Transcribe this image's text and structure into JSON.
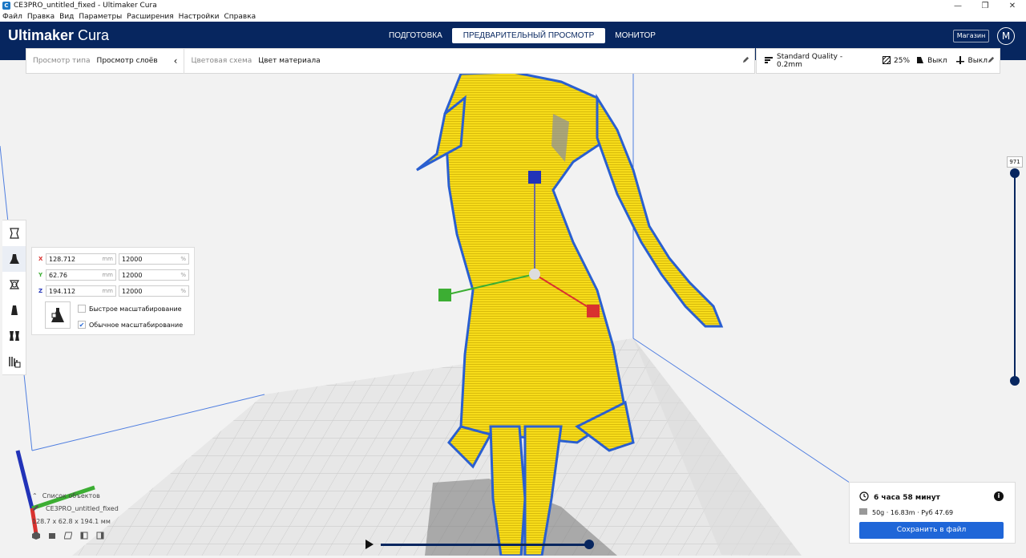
{
  "window": {
    "title": "CE3PRO_untitled_fixed - Ultimaker Cura",
    "app_icon": "C",
    "minimize": "—",
    "restore": "❐",
    "close": "✕"
  },
  "menu": [
    "Файл",
    "Правка",
    "Вид",
    "Параметры",
    "Расширения",
    "Настройки",
    "Справка"
  ],
  "header": {
    "brand_bold": "Ultimaker",
    "brand_light": " Cura",
    "stages": [
      {
        "label": "ПОДГОТОВКА",
        "active": false
      },
      {
        "label": "ПРЕДВАРИТЕЛЬНЫЙ ПРОСМОТР",
        "active": true
      },
      {
        "label": "МОНИТОР",
        "active": false
      }
    ],
    "marketplace": "Магазин",
    "avatar": "M",
    "bg_color": "#07265f"
  },
  "view_bar": {
    "view_type_label": "Просмотр типа",
    "view_type_value": "Просмотр слоёв",
    "color_scheme_label": "Цветовая схема",
    "color_scheme_value": "Цвет материала"
  },
  "print_settings": {
    "profile": "Standard Quality - 0.2mm",
    "infill": "25%",
    "support": "Выкл",
    "adhesion": "Выкл"
  },
  "scale_panel": {
    "rows": [
      {
        "axis": "X",
        "color": "#d9322f",
        "size": "128.712",
        "size_unit": "mm",
        "percent": "12000",
        "percent_unit": "%"
      },
      {
        "axis": "Y",
        "color": "#3cae33",
        "size": "62.76",
        "size_unit": "mm",
        "percent": "12000",
        "percent_unit": "%"
      },
      {
        "axis": "Z",
        "color": "#2233b8",
        "size": "194.112",
        "size_unit": "mm",
        "percent": "12000",
        "percent_unit": "%"
      }
    ],
    "snap_scaling": {
      "label": "Быстрое масштабирование",
      "checked": false
    },
    "uniform_scaling": {
      "label": "Обычное масштабирование",
      "checked": true
    }
  },
  "layer_slider": {
    "current_layer": "971"
  },
  "object_list": {
    "title": "Список объектов",
    "object_name": "CE3PRO_untitled_fixed",
    "dimensions": "128.7 x 62.8 x 194.1 мм"
  },
  "print_info": {
    "time": "6 часа 58 минут",
    "material": "50g · 16.83m · Руб 47.69",
    "save_button": "Сохранить в файл",
    "info_glyph": "i",
    "accent": "#1f66d8"
  },
  "model": {
    "color": "#f7dc1a",
    "outline": "#2a5fd0"
  }
}
